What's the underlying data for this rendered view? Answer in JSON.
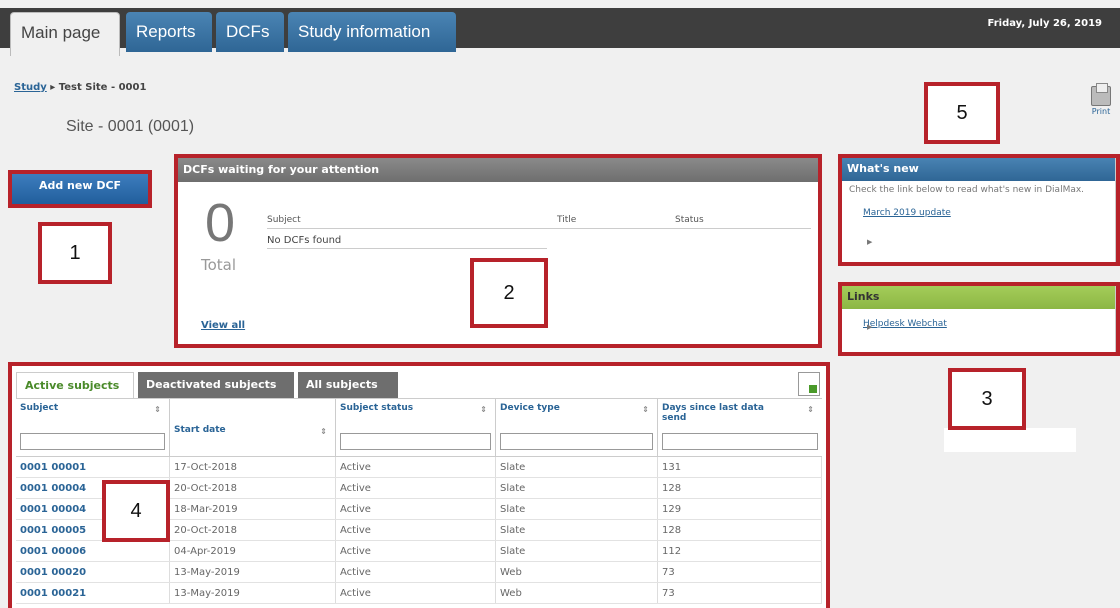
{
  "nav": {
    "tabs": [
      {
        "label": "Main page"
      },
      {
        "label": "Reports"
      },
      {
        "label": "DCFs"
      },
      {
        "label": "Study information"
      }
    ],
    "date": "Friday, July 26, 2019"
  },
  "breadcrumb": {
    "root": "Study",
    "separator": "▸",
    "current": "Test Site - 0001"
  },
  "site_title": "Site - 0001 (0001)",
  "print_label": "Print",
  "add_button": "Add new DCF",
  "dcf_panel": {
    "title": "DCFs waiting for your attention",
    "count": "0",
    "total_label": "Total",
    "columns": [
      "Subject",
      "Title",
      "Status"
    ],
    "empty_text": "No DCFs found",
    "view_all": "View all"
  },
  "whats_new": {
    "title": "What's new",
    "text": "Check the link below to read what's new in DialMax.",
    "link": "March 2019 update"
  },
  "links": {
    "title": "Links",
    "link": "Helpdesk Webchat"
  },
  "subjects": {
    "tabs": [
      "Active subjects",
      "Deactivated subjects",
      "All subjects"
    ],
    "columns": [
      "Subject",
      "Start date",
      "Subject status",
      "Device type",
      "Days since last data send"
    ],
    "rows": [
      [
        "0001 00001",
        "17-Oct-2018",
        "Active",
        "Slate",
        "131"
      ],
      [
        "0001 00004",
        "20-Oct-2018",
        "Active",
        "Slate",
        "128"
      ],
      [
        "0001 00004",
        "18-Mar-2019",
        "Active",
        "Slate",
        "129"
      ],
      [
        "0001 00005",
        "20-Oct-2018",
        "Active",
        "Slate",
        "128"
      ],
      [
        "0001 00006",
        "04-Apr-2019",
        "Active",
        "Slate",
        "112"
      ],
      [
        "0001 00020",
        "13-May-2019",
        "Active",
        "Web",
        "73"
      ],
      [
        "0001 00021",
        "13-May-2019",
        "Active",
        "Web",
        "73"
      ]
    ]
  },
  "annotations": [
    "1",
    "2",
    "3",
    "4",
    "5"
  ]
}
